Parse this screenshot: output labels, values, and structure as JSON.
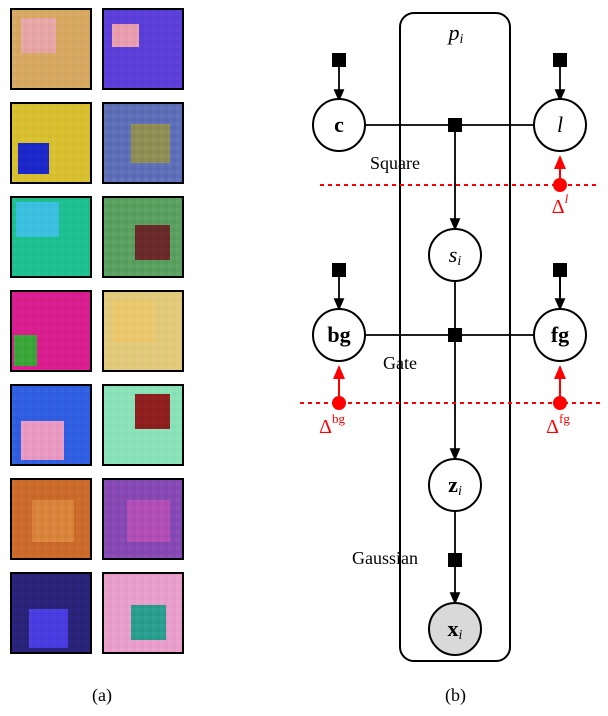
{
  "panel_a": {
    "caption": "(a)",
    "tiles": [
      {
        "bg": "#d6a861",
        "fg": "#e7a6a6",
        "fx": 0.12,
        "fy": 0.1,
        "fw": 0.45,
        "fh": 0.45
      },
      {
        "bg": "#5b3fd9",
        "fg": "#e89eae",
        "fx": 0.1,
        "fy": 0.18,
        "fw": 0.35,
        "fh": 0.3
      },
      {
        "bg": "#d8bf2f",
        "fg": "#1b27c9",
        "fx": 0.08,
        "fy": 0.5,
        "fw": 0.4,
        "fh": 0.4
      },
      {
        "bg": "#5e6fb8",
        "fg": "#8f8f55",
        "fx": 0.35,
        "fy": 0.25,
        "fw": 0.5,
        "fh": 0.5
      },
      {
        "bg": "#1dbf8e",
        "fg": "#3cc0e0",
        "fx": 0.05,
        "fy": 0.05,
        "fw": 0.55,
        "fh": 0.45
      },
      {
        "bg": "#5aa060",
        "fg": "#6a2a2a",
        "fx": 0.4,
        "fy": 0.35,
        "fw": 0.45,
        "fh": 0.45
      },
      {
        "bg": "#d81e8e",
        "fg": "#3aa63a",
        "fx": 0.02,
        "fy": 0.55,
        "fw": 0.3,
        "fh": 0.4
      },
      {
        "bg": "#e0c97a",
        "fg": "#eac86e",
        "fx": 0.1,
        "fy": 0.1,
        "fw": 0.55,
        "fh": 0.55
      },
      {
        "bg": "#2f5fe0",
        "fg": "#e99ac2",
        "fx": 0.12,
        "fy": 0.45,
        "fw": 0.55,
        "fh": 0.5
      },
      {
        "bg": "#89e2b8",
        "fg": "#8f1f1f",
        "fx": 0.4,
        "fy": 0.1,
        "fw": 0.45,
        "fh": 0.45
      },
      {
        "bg": "#cb6a2b",
        "fg": "#d9843d",
        "fx": 0.25,
        "fy": 0.25,
        "fw": 0.55,
        "fh": 0.55
      },
      {
        "bg": "#8649b3",
        "fg": "#b24fb6",
        "fx": 0.3,
        "fy": 0.25,
        "fw": 0.55,
        "fh": 0.55
      },
      {
        "bg": "#2a237a",
        "fg": "#4a3de0",
        "fx": 0.22,
        "fy": 0.45,
        "fw": 0.5,
        "fh": 0.5
      },
      {
        "bg": "#e89eca",
        "fg": "#2a9e8f",
        "fx": 0.35,
        "fy": 0.4,
        "fw": 0.45,
        "fh": 0.45
      }
    ]
  },
  "panel_b": {
    "caption": "(b)",
    "plate_label": "p_i",
    "nodes": {
      "c": {
        "label": "c",
        "bold": true,
        "observed": false
      },
      "l": {
        "label": "l",
        "italic": true,
        "observed": false
      },
      "bg": {
        "label": "bg",
        "bold": true,
        "observed": false
      },
      "fg": {
        "label": "fg",
        "bold": true,
        "observed": false
      },
      "s": {
        "label": "s_i",
        "italic": true,
        "observed": false
      },
      "z": {
        "label": "z_i",
        "bold": true,
        "observed": false
      },
      "x": {
        "label": "x_i",
        "bold": true,
        "observed": true
      }
    },
    "factor_labels": {
      "square": "Square",
      "gate": "Gate",
      "gaussian": "Gaussian"
    },
    "interventions": {
      "delta_l": "Δ^l",
      "delta_bg": "Δ^bg",
      "delta_fg": "Δ^fg"
    }
  }
}
